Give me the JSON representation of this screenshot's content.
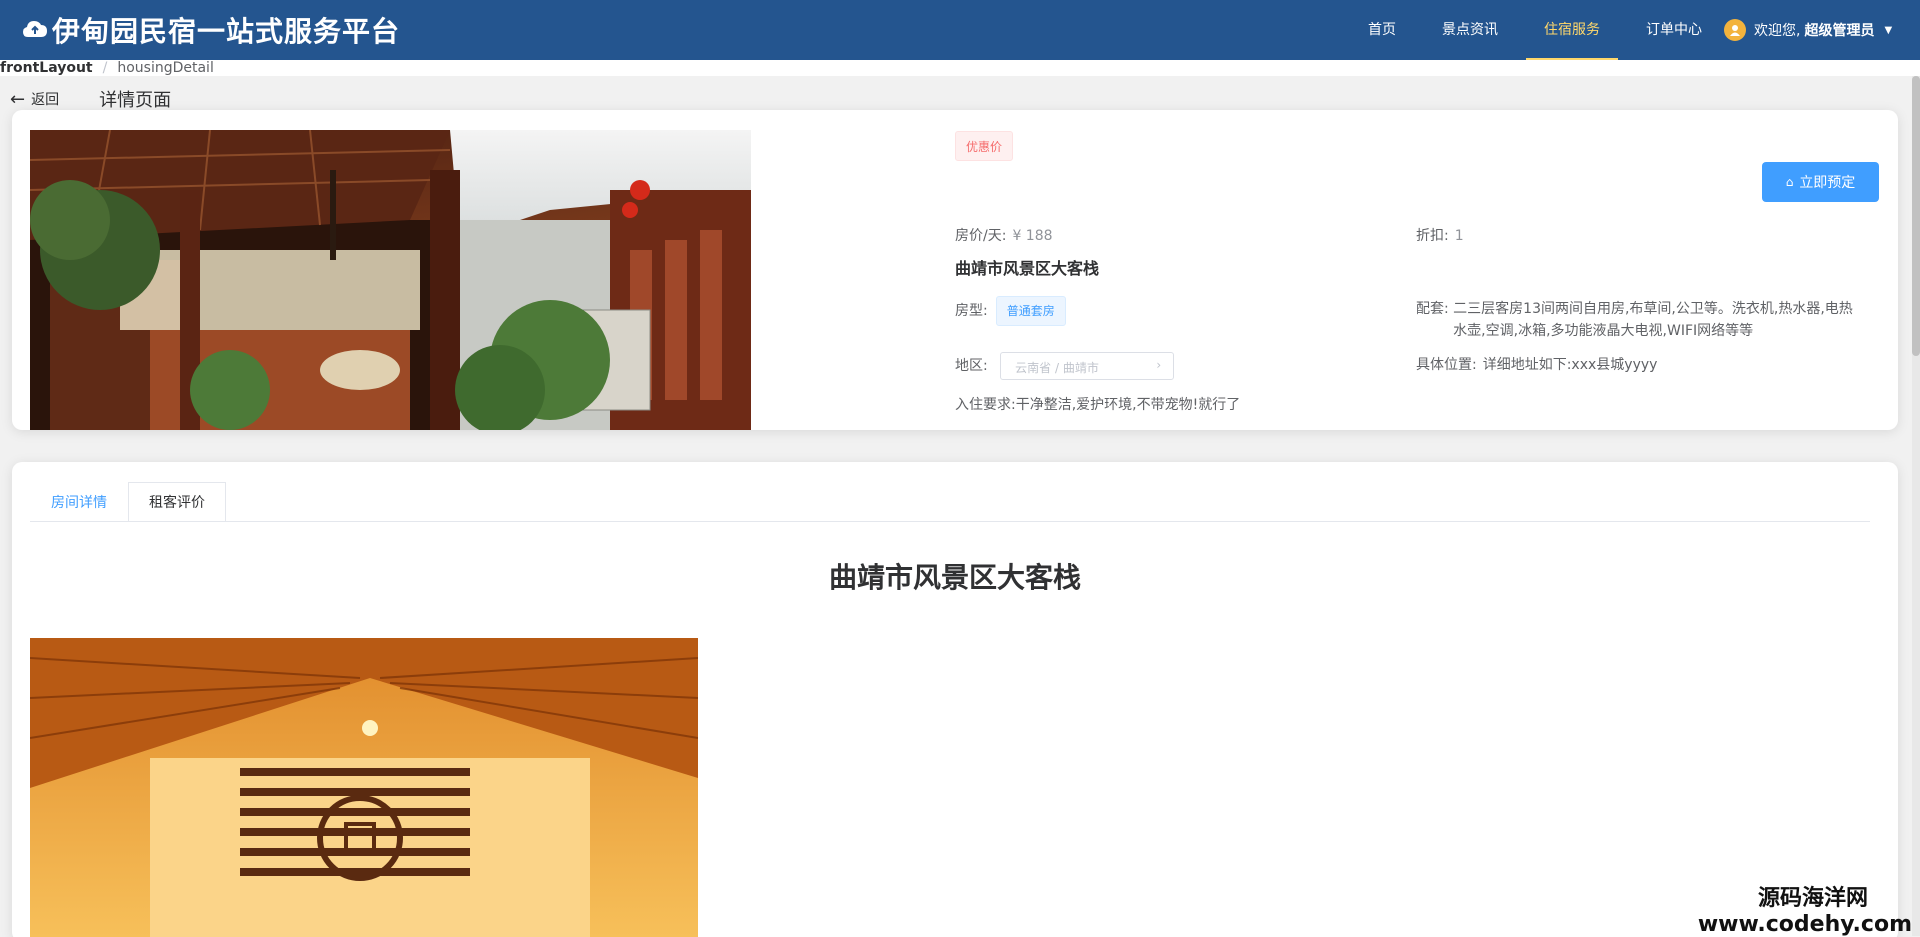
{
  "header": {
    "title": "伊甸园民宿一站式服务平台",
    "nav": [
      "首页",
      "景点资讯",
      "住宿服务",
      "订单中心"
    ],
    "active_nav": "住宿服务",
    "user_greeting": "欢迎您,",
    "user_role": "超级管理员"
  },
  "breadcrumb": {
    "first": "frontLayout",
    "separator": "/",
    "second": "housingDetail"
  },
  "page_header": {
    "back": "返回",
    "title": "详情页面"
  },
  "detail": {
    "discount_tag": "优惠价",
    "book_button": "立即预定",
    "price_label": "房价/天:",
    "price_value": "¥ 188",
    "discount_label": "折扣:",
    "discount_value": "1",
    "name": "曲靖市风景区大客栈",
    "room_type_label": "房型:",
    "room_type_value": "普通套房",
    "facilities_label": "配套:",
    "facilities_value": "二三层客房13间两间自用房,布草间,公卫等。洗衣机,热水器,电热水壶,空调,冰箱,多功能液晶大电视,WIFI网络等等",
    "region_label": "地区:",
    "region_placeholder": "云南省 / 曲靖市",
    "address_label": "具体位置:",
    "address_value": "详细地址如下:xxx县城yyyy",
    "requirement_label": "入住要求:",
    "requirement_value": "干净整洁,爱护环境,不带宠物!就行了"
  },
  "tabs": [
    {
      "label": "房间详情",
      "active": true
    },
    {
      "label": "租客评价",
      "active": false
    }
  ],
  "content": {
    "title": "曲靖市风景区大客栈"
  },
  "watermark": {
    "line1": "源码海洋网",
    "line2": "www.codehy.com"
  },
  "colors": {
    "header_bg": "#24558f",
    "primary": "#409eff",
    "danger": "#f56c6c",
    "active_nav": "#ffd86b"
  }
}
